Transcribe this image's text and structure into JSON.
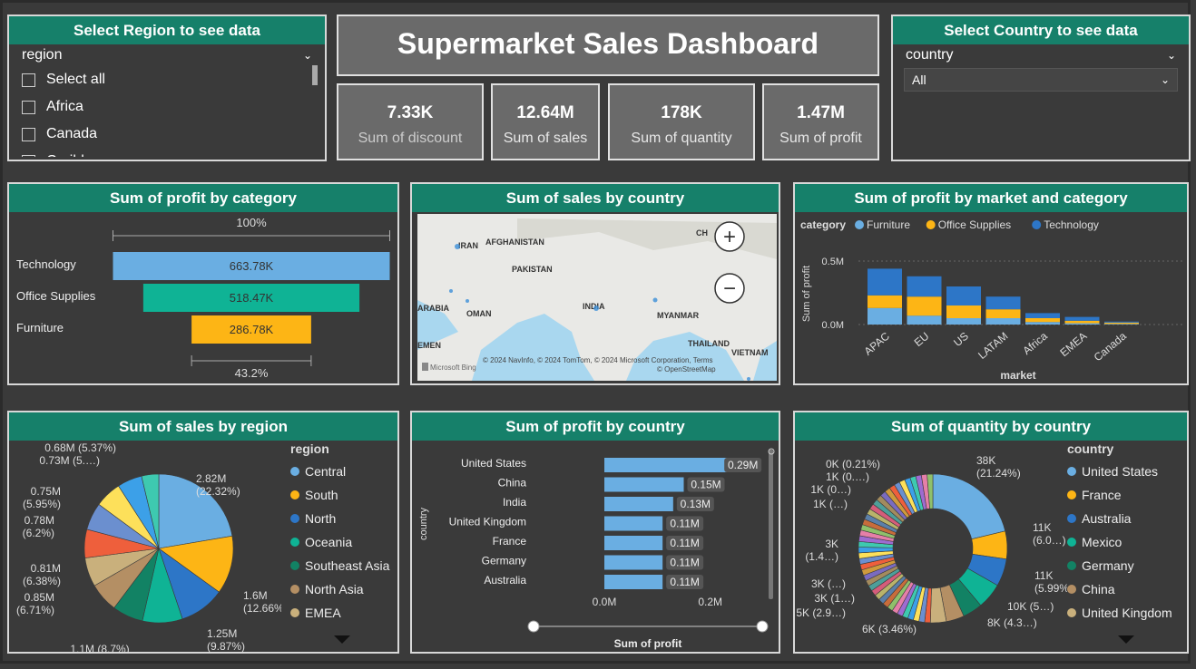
{
  "title": "Supermarket Sales Dashboard",
  "region_slicer": {
    "header": "Select Region to see data",
    "field": "region",
    "items": [
      "Select all",
      "Africa",
      "Canada",
      "Caribbean"
    ]
  },
  "country_slicer": {
    "header": "Select Country to see data",
    "field": "country",
    "selected": "All"
  },
  "kpis": [
    {
      "value": "7.33K",
      "label": "Sum of discount"
    },
    {
      "value": "12.64M",
      "label": "Sum of sales"
    },
    {
      "value": "178K",
      "label": "Sum of quantity"
    },
    {
      "value": "1.47M",
      "label": "Sum of profit"
    }
  ],
  "colors": {
    "light_blue": "#6aaee2",
    "yellow": "#fdb515",
    "blue": "#2d76c7",
    "teal": "#0fb395",
    "dark_teal": "#128264",
    "tan": "#b48f64",
    "beige": "#c9b07c",
    "header_green": "#16806a"
  },
  "map": {
    "header": "Sum of sales by country",
    "labels": [
      "IRAN",
      "AFGHANISTAN",
      "PAKISTAN",
      "INDIA",
      "MYANMAR",
      "ARABIA",
      "OMAN",
      "THAILAND",
      "VIETNAM",
      "CH",
      "EMEN"
    ],
    "attribution": "© 2024 NavInfo, © 2024 TomTom, © 2024 Microsoft Corporation, Terms",
    "attribution2": "© OpenStreetMap",
    "bing": "Microsoft Bing",
    "zoom_in": "+",
    "zoom_out": "−"
  },
  "chart_data": [
    {
      "id": "profit_by_category",
      "type": "bar",
      "title": "Sum of profit by category",
      "top_label": "100%",
      "bottom_label": "43.2%",
      "categories": [
        "Technology",
        "Office Supplies",
        "Furniture"
      ],
      "values": [
        663780,
        518470,
        286780
      ],
      "data_labels": [
        "663.78K",
        "518.47K",
        "286.78K"
      ],
      "colors": [
        "#6aaee2",
        "#0fb395",
        "#fdb515"
      ]
    },
    {
      "id": "profit_by_market_category",
      "type": "bar",
      "title": "Sum of profit by market and category",
      "legend_title": "category",
      "xlabel": "market",
      "ylabel": "Sum of profit",
      "yticks": [
        "0.5M",
        "0.0M"
      ],
      "ylim": [
        0,
        0.6
      ],
      "categories": [
        "APAC",
        "EU",
        "US",
        "LATAM",
        "Africa",
        "EMEA",
        "Canada"
      ],
      "series": [
        {
          "name": "Furniture",
          "color": "#6aaee2",
          "values": [
            0.13,
            0.07,
            0.05,
            0.05,
            0.02,
            0.01,
            0.005
          ]
        },
        {
          "name": "Office Supplies",
          "color": "#fdb515",
          "values": [
            0.1,
            0.15,
            0.1,
            0.07,
            0.03,
            0.02,
            0.01
          ]
        },
        {
          "name": "Technology",
          "color": "#2d76c7",
          "values": [
            0.21,
            0.16,
            0.15,
            0.1,
            0.04,
            0.03,
            0.008
          ]
        }
      ]
    },
    {
      "id": "sales_by_region",
      "type": "pie",
      "title": "Sum of sales by region",
      "legend_title": "region",
      "legend": [
        "Central",
        "South",
        "North",
        "Oceania",
        "Southeast Asia",
        "North Asia",
        "EMEA"
      ],
      "slices": [
        {
          "label": "2.82M\n(22.32%)",
          "value": 22.32,
          "color": "#6aaee2"
        },
        {
          "label": "1.6M\n(12.66%)",
          "value": 12.66,
          "color": "#fdb515"
        },
        {
          "label": "1.25M\n(9.87%)",
          "value": 9.87,
          "color": "#2d76c7"
        },
        {
          "label": "1.1M (8.7%)",
          "value": 8.7,
          "color": "#0fb395"
        },
        {
          "label": "0.85M\n(6.71%)",
          "value": 6.71,
          "color": "#128264"
        },
        {
          "label": "0.81M\n(6.38%)",
          "value": 6.38,
          "color": "#b48f64"
        },
        {
          "label": "",
          "value": 6.3,
          "color": "#c9b07c"
        },
        {
          "label": "0.78M\n(6.2%)",
          "value": 6.2,
          "color": "#ee5f3c"
        },
        {
          "label": "0.75M\n(5.95%)",
          "value": 5.95,
          "color": "#6b8fcf"
        },
        {
          "label": "0.73M (5.…)",
          "value": 5.8,
          "color": "#fde05a"
        },
        {
          "label": "0.68M (5.37%)",
          "value": 5.37,
          "color": "#3ca0e8"
        },
        {
          "label": "",
          "value": 3.74,
          "color": "#3ec9b0"
        }
      ]
    },
    {
      "id": "profit_by_country",
      "type": "bar",
      "title": "Sum of profit by country",
      "xlabel": "Sum of profit",
      "ylabel": "country",
      "xticks": [
        "0.0M",
        "0.2M"
      ],
      "xlim": [
        0,
        0.35
      ],
      "categories": [
        "United States",
        "China",
        "India",
        "United Kingdom",
        "France",
        "Germany",
        "Australia"
      ],
      "values": [
        0.29,
        0.15,
        0.13,
        0.11,
        0.11,
        0.11,
        0.11
      ],
      "data_labels": [
        "0.29M",
        "0.15M",
        "0.13M",
        "0.11M",
        "0.11M",
        "0.11M",
        "0.11M"
      ]
    },
    {
      "id": "quantity_by_country",
      "type": "pie",
      "title": "Sum of quantity by country",
      "legend_title": "country",
      "legend": [
        "United States",
        "France",
        "Australia",
        "Mexico",
        "Germany",
        "China",
        "United Kingdom"
      ],
      "slices": [
        {
          "label": "38K\n(21.24%)",
          "value": 21.24,
          "color": "#6aaee2"
        },
        {
          "label": "11K\n(6.0…)",
          "value": 6.05,
          "color": "#fdb515"
        },
        {
          "label": "11K\n(5.99%)",
          "value": 5.99,
          "color": "#2d76c7"
        },
        {
          "label": "10K (5…)",
          "value": 5.6,
          "color": "#0fb395"
        },
        {
          "label": "8K (4.3…)",
          "value": 4.3,
          "color": "#128264"
        },
        {
          "label": "",
          "value": 3.9,
          "color": "#b48f64"
        },
        {
          "label": "6K (3.46%)",
          "value": 3.46,
          "color": "#c9b07c"
        }
      ],
      "other_labels": [
        "5K (2.9…)",
        "3K (1…)",
        "3K (…)",
        "3K\n(1.4…)",
        "1K (…)",
        "1K (0…)",
        "1K (0.…)",
        "0K (0.21%)"
      ]
    }
  ]
}
